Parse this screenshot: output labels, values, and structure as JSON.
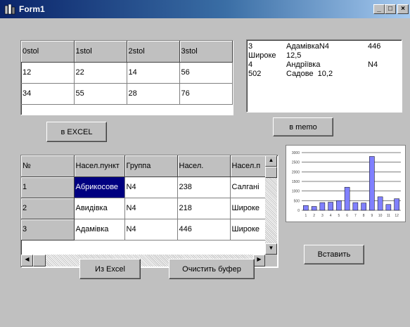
{
  "window": {
    "title": "Form1",
    "controls": {
      "minimize": "_",
      "maximize": "□",
      "close": "×"
    }
  },
  "grid_top": {
    "headers": [
      "0stol",
      "1stol",
      "2stol",
      "3stol"
    ],
    "rows": [
      [
        "12",
        "22",
        "14",
        "56"
      ],
      [
        "34",
        "55",
        "28",
        "76"
      ]
    ]
  },
  "memo": {
    "lines": [
      [
        "3",
        "АдамівкаN4",
        "446"
      ],
      [
        "Широке",
        "12,5",
        ""
      ],
      [
        "4",
        "Андріївка",
        "N4"
      ],
      [
        "502",
        "Садове  10,2",
        ""
      ]
    ]
  },
  "buttons": {
    "to_excel": "в EXCEL",
    "to_memo": "в memo",
    "from_excel": "Из Excel",
    "clear_buffer": "Очистить буфер",
    "insert": "Вставить"
  },
  "grid_main": {
    "headers": [
      "№",
      "Насел.пункт",
      "Группа",
      "Насел.",
      "Насел.п"
    ],
    "rows": [
      [
        "1",
        "Абрикосове",
        "N4",
        "238",
        "Салгані"
      ],
      [
        "2",
        "Авидівка",
        "N4",
        "218",
        "Широке"
      ],
      [
        "3",
        "Адамівка",
        "N4",
        "446",
        "Широке"
      ]
    ]
  },
  "chart_data": {
    "type": "bar",
    "categories": [
      "1",
      "2",
      "3",
      "4",
      "5",
      "6",
      "7",
      "8",
      "9",
      "10",
      "11",
      "12"
    ],
    "series": [
      {
        "values": [
          250,
          200,
          400,
          420,
          500,
          1200,
          400,
          380,
          2800,
          700,
          300,
          600
        ]
      }
    ],
    "ylim": [
      0,
      3000
    ],
    "yticks": [
      "3000",
      "2500",
      "2000",
      "1500",
      "1000",
      "500",
      "0"
    ],
    "grid": true,
    "bar_color": "#8080ff"
  }
}
